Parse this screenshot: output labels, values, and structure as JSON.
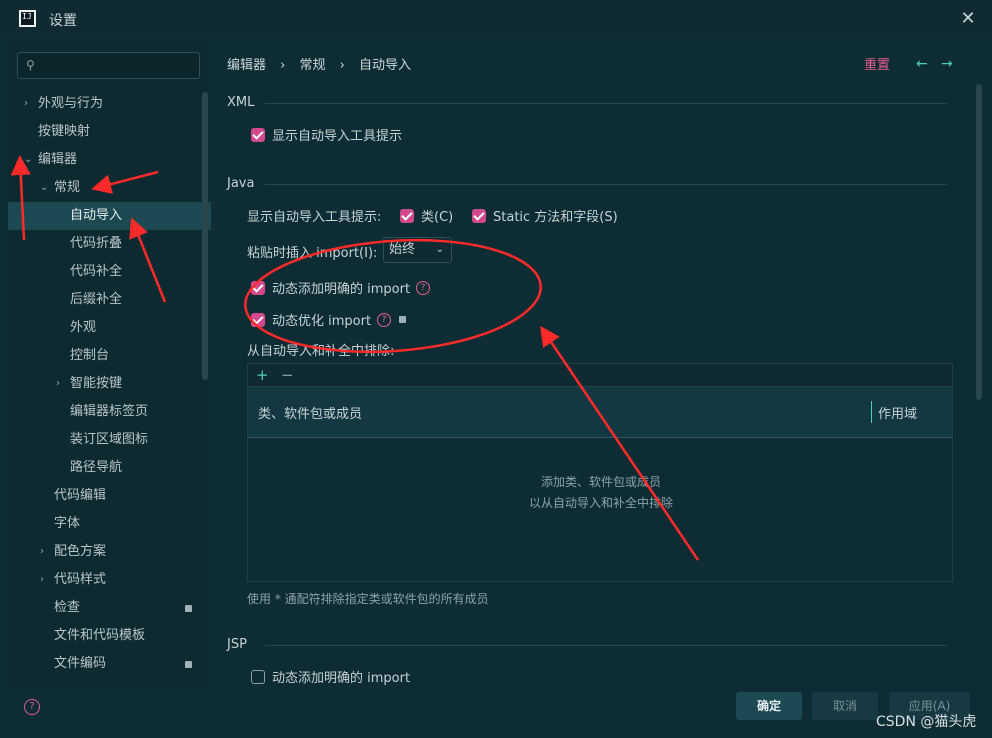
{
  "window": {
    "title": "设置",
    "app_icon_text": "IJ"
  },
  "sidebar": {
    "items": [
      {
        "label": "外观与行为"
      },
      {
        "label": "按键映射"
      },
      {
        "label": "编辑器"
      },
      {
        "label": "常规"
      },
      {
        "label": "自动导入"
      },
      {
        "label": "代码折叠"
      },
      {
        "label": "代码补全"
      },
      {
        "label": "后缀补全"
      },
      {
        "label": "外观"
      },
      {
        "label": "控制台"
      },
      {
        "label": "智能按键"
      },
      {
        "label": "编辑器标签页"
      },
      {
        "label": "装订区域图标"
      },
      {
        "label": "路径导航"
      },
      {
        "label": "代码编辑"
      },
      {
        "label": "字体"
      },
      {
        "label": "配色方案"
      },
      {
        "label": "代码样式"
      },
      {
        "label": "检查"
      },
      {
        "label": "文件和代码模板"
      },
      {
        "label": "文件编码"
      }
    ]
  },
  "breadcrumb": {
    "parts": [
      "编辑器",
      "常规",
      "自动导入"
    ]
  },
  "reset_label": "重置",
  "xml": {
    "title": "XML",
    "show_popup": "显示自动导入工具提示"
  },
  "java": {
    "title": "Java",
    "show_popup_label": "显示自动导入工具提示:",
    "classes": "类(C)",
    "static": "Static 方法和字段(S)",
    "paste_label": "粘贴时插入 import(I):",
    "paste_value": "始终",
    "add_unambiguous": "动态添加明确的 import",
    "optimize": "动态优化 import",
    "exclude_label": "从自动导入和补全中排除:",
    "table": {
      "col_class": "类、软件包或成员",
      "col_scope": "作用域",
      "empty_line1": "添加类、软件包或成员",
      "empty_line2": "以从自动导入和补全中排除"
    },
    "hint": "使用 * 通配符排除指定类或软件包的所有成员"
  },
  "jsp": {
    "title": "JSP",
    "add_unambiguous": "动态添加明确的 import"
  },
  "buttons": {
    "ok": "确定",
    "cancel": "取消",
    "apply": "应用(A)"
  },
  "watermark": "CSDN @猫头虎",
  "colors": {
    "accent": "#d24a8c",
    "annotation": "#ff2a2a",
    "link": "#4fd1b7"
  }
}
